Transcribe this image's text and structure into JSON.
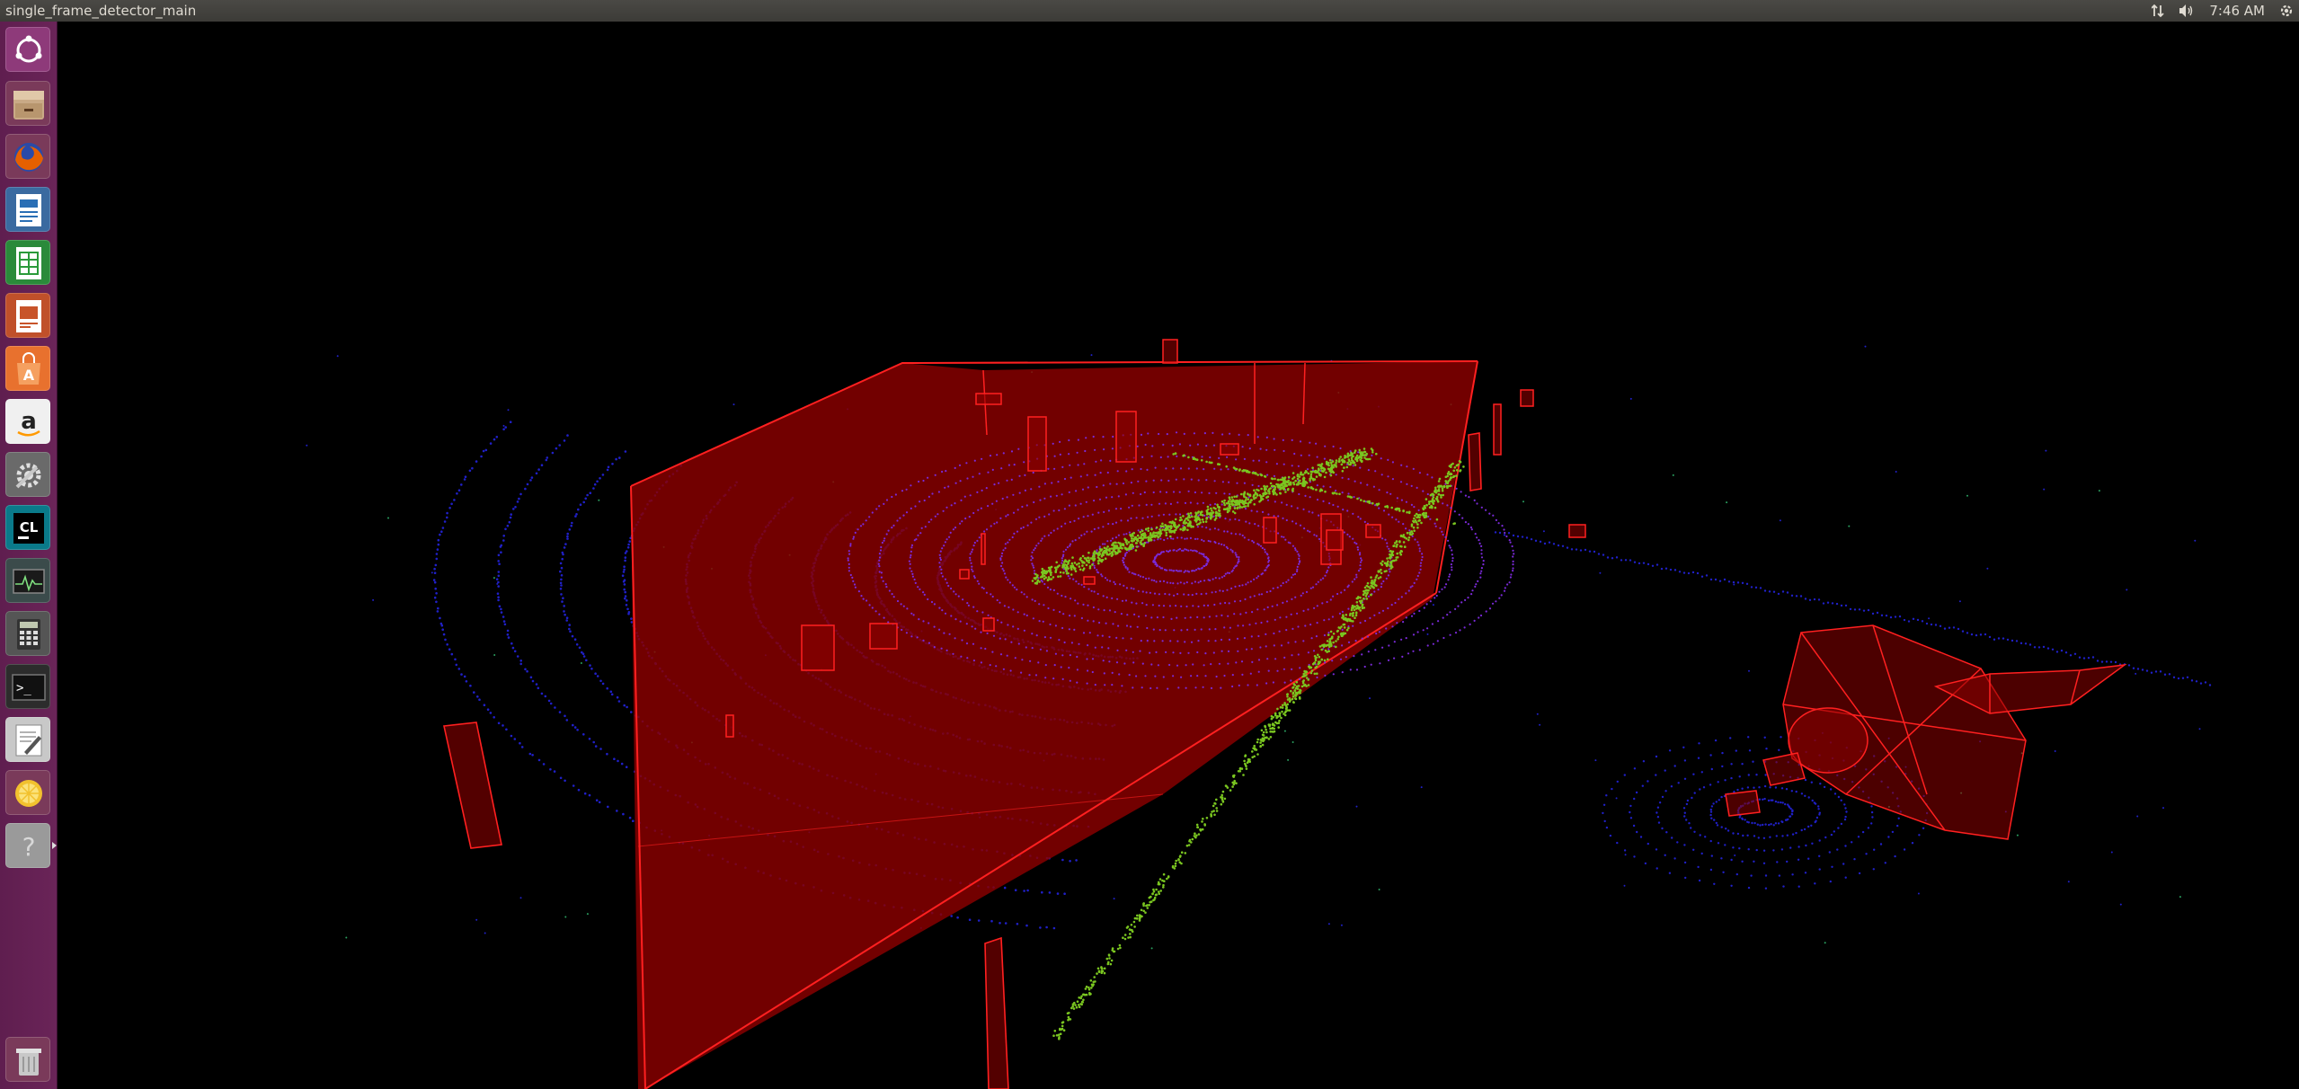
{
  "topbar": {
    "window_title": "single_frame_detector_main",
    "clock": "7:46 AM",
    "indicators": [
      "network-updown-icon",
      "volume-icon",
      "settings-gear-icon"
    ]
  },
  "launcher": {
    "items": [
      {
        "name": "ubuntu-dash",
        "icon": "ubuntu-logo-icon",
        "color": "#8e3a7a"
      },
      {
        "name": "files",
        "icon": "file-cabinet-icon",
        "color": "#c9aa86"
      },
      {
        "name": "firefox",
        "icon": "firefox-icon",
        "color": "#e66000"
      },
      {
        "name": "libreoffice-writer",
        "icon": "writer-document-icon",
        "color": "#2a6fb5"
      },
      {
        "name": "libreoffice-calc",
        "icon": "calc-spreadsheet-icon",
        "color": "#2a9a3a"
      },
      {
        "name": "libreoffice-impress",
        "icon": "impress-presentation-icon",
        "color": "#c8542a"
      },
      {
        "name": "software-center",
        "icon": "shopping-bag-icon",
        "color": "#e8712e"
      },
      {
        "name": "amazon",
        "icon": "amazon-logo-icon",
        "color": "#ffffff"
      },
      {
        "name": "system-settings",
        "icon": "wrench-gear-icon",
        "color": "#8a8a8a"
      },
      {
        "name": "clion",
        "icon": "clion-icon",
        "color": "#21d789"
      },
      {
        "name": "system-monitor",
        "icon": "system-monitor-icon",
        "color": "#3b4b4b"
      },
      {
        "name": "calculator",
        "icon": "calculator-icon",
        "color": "#555555"
      },
      {
        "name": "terminal",
        "icon": "terminal-icon",
        "color": "#2c2c2c"
      },
      {
        "name": "text-editor",
        "icon": "text-editor-icon",
        "color": "#d8d8d8"
      },
      {
        "name": "lemon-app",
        "icon": "lemon-icon",
        "color": "#f2c12e"
      },
      {
        "name": "unknown-app",
        "icon": "question-mark-icon",
        "color": "#9a9a9a"
      },
      {
        "name": "trash",
        "icon": "trash-icon",
        "color": "#a9a9a9"
      }
    ],
    "clion_label": "CL",
    "terminal_label": ">_",
    "amazon_label": "a",
    "unknown_label": "?"
  },
  "colors": {
    "box": "#ff2020",
    "box_fill": "#8b0000",
    "ground_points": "#2020c8",
    "ring_points": "#7a2ad8",
    "vegetation_points": "#7ac620",
    "launcher_bg": "#6a2458",
    "topbar_bg": "#3c3b37"
  }
}
